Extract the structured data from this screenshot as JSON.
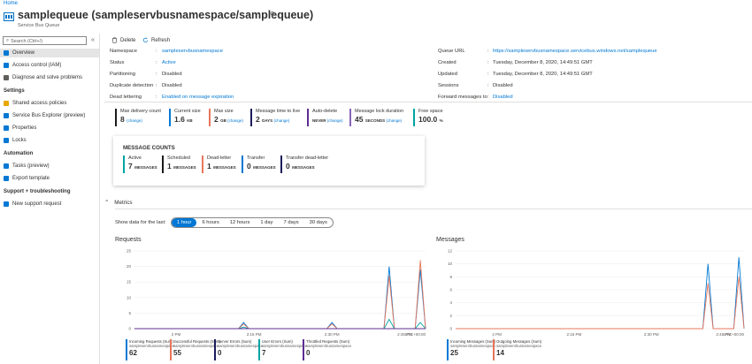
{
  "breadcrumb": "Home",
  "header": {
    "title": "samplequeue (sampleservbusnamespace/samplequeue)",
    "subtitle": "Service Bus Queue",
    "pin_icon": "pin-icon"
  },
  "sidebar": {
    "search_placeholder": "Search (Ctrl+/)",
    "collapse_glyph": "«",
    "items": [
      {
        "label": "Overview",
        "icon": "overview-icon",
        "color": "#0078d4"
      },
      {
        "label": "Access control (IAM)",
        "icon": "people-icon",
        "color": "#0078d4"
      },
      {
        "label": "Diagnose and solve problems",
        "icon": "wrench-icon",
        "color": "#605e5c"
      }
    ],
    "sections": [
      {
        "title": "Settings",
        "items": [
          {
            "label": "Shared access policies",
            "icon": "key-icon",
            "color": "#e8a700"
          },
          {
            "label": "Service Bus Explorer (preview)",
            "icon": "explorer-icon",
            "color": "#0078d4"
          },
          {
            "label": "Properties",
            "icon": "properties-icon",
            "color": "#0078d4"
          },
          {
            "label": "Locks",
            "icon": "lock-icon",
            "color": "#0078d4"
          }
        ]
      },
      {
        "title": "Automation",
        "items": [
          {
            "label": "Tasks (preview)",
            "icon": "tasks-icon",
            "color": "#0078d4"
          },
          {
            "label": "Export template",
            "icon": "export-icon",
            "color": "#0078d4"
          }
        ]
      },
      {
        "title": "Support + troubleshooting",
        "items": [
          {
            "label": "New support request",
            "icon": "support-icon",
            "color": "#0078d4"
          }
        ]
      }
    ]
  },
  "toolbar": {
    "delete_label": "Delete",
    "refresh_label": "Refresh"
  },
  "essentials": {
    "left": [
      {
        "label": "Namespace",
        "value": "sampleservbusnamespace",
        "link": true
      },
      {
        "label": "Status",
        "value": "Active",
        "link": true
      },
      {
        "label": "Partitioning",
        "value": "Disabled",
        "link": false
      },
      {
        "label": "Duplicate detection",
        "value": "Disabled",
        "link": false
      },
      {
        "label": "Dead lettering",
        "value": "Enabled on message expiration",
        "link": true
      }
    ],
    "right": [
      {
        "label": "Queue URL",
        "value": "https://sampleservbusnamespace.servicebus.windows.net/samplequeue",
        "link": true
      },
      {
        "label": "Created",
        "value": "Tuesday, December 8, 2020, 14:49:51 GMT",
        "link": false
      },
      {
        "label": "Updated",
        "value": "Tuesday, December 8, 2020, 14:49:51 GMT",
        "link": false
      },
      {
        "label": "Sessions",
        "value": "Disabled",
        "link": false
      },
      {
        "label": "Forward messages to",
        "value": "Disabled",
        "link": true
      }
    ]
  },
  "tiles": [
    {
      "label": "Max delivery count",
      "value": "8",
      "unit": "",
      "change": "(change)",
      "color": "#1b1b1b"
    },
    {
      "label": "Current size",
      "value": "1.6",
      "unit": "KB",
      "change": "",
      "color": "#0078d4"
    },
    {
      "label": "Max size",
      "value": "2",
      "unit": "GB",
      "change": "(change)",
      "color": "#e8765a"
    },
    {
      "label": "Message time to live",
      "value": "2",
      "unit": "DAYS",
      "change": "(change)",
      "color": "#1b1b5a"
    },
    {
      "label": "Auto-delete",
      "value": "",
      "unit": "NEVER",
      "change": "(change)",
      "color": "#5c2d91"
    },
    {
      "label": "Message lock duration",
      "value": "45",
      "unit": "SECONDS",
      "change": "(change)",
      "color": "#8764b8"
    },
    {
      "label": "Free space",
      "value": "100.0",
      "unit": "%",
      "change": "",
      "color": "#00a3a3"
    }
  ],
  "message_counts": {
    "title": "MESSAGE COUNTS",
    "items": [
      {
        "label": "Active",
        "value": "7",
        "unit": "MESSAGES",
        "color": "#00a3a3"
      },
      {
        "label": "Scheduled",
        "value": "1",
        "unit": "MESSAGES",
        "color": "#1b1b1b"
      },
      {
        "label": "Dead-letter",
        "value": "1",
        "unit": "MESSAGES",
        "color": "#e8765a"
      },
      {
        "label": "Transfer",
        "value": "0",
        "unit": "MESSAGES",
        "color": "#0078d4"
      },
      {
        "label": "Transfer dead-letter",
        "value": "0",
        "unit": "MESSAGES",
        "color": "#1b1b5a"
      }
    ]
  },
  "metrics": {
    "title": "Metrics",
    "show_label": "Show data for the last:",
    "ranges": [
      "1 hour",
      "6 hours",
      "12 hours",
      "1 day",
      "7 days",
      "30 days"
    ],
    "selected": "1 hour"
  },
  "chart_data": [
    {
      "type": "line",
      "title": "Requests",
      "x_ticks": [
        "2 PM",
        "2:15 PM",
        "2:30 PM",
        "2:45 PM",
        "UTC+00:00"
      ],
      "ylim": [
        0,
        25
      ],
      "y_ticks": [
        0,
        5,
        10,
        15,
        20,
        25
      ],
      "series": [
        {
          "name": "Incoming Requests (Sum)",
          "color": "#0078d4",
          "points": [
            [
              0,
              0
            ],
            [
              20,
              0
            ],
            [
              21,
              2
            ],
            [
              22,
              0
            ],
            [
              37,
              0
            ],
            [
              38,
              2
            ],
            [
              39,
              0
            ],
            [
              48,
              0
            ],
            [
              49,
              20
            ],
            [
              50,
              0
            ],
            [
              54,
              0
            ],
            [
              55,
              19
            ],
            [
              56,
              0
            ]
          ]
        },
        {
          "name": "Successful Requests (Sum)",
          "color": "#e8765a",
          "points": [
            [
              0,
              0
            ],
            [
              20,
              0
            ],
            [
              21,
              1.5
            ],
            [
              22,
              0
            ],
            [
              37,
              0
            ],
            [
              38,
              1.5
            ],
            [
              39,
              0
            ],
            [
              48,
              0
            ],
            [
              49,
              17
            ],
            [
              50,
              0
            ],
            [
              54,
              0
            ],
            [
              55,
              22
            ],
            [
              56,
              0
            ]
          ]
        },
        {
          "name": "Server Errors (Sum)",
          "color": "#1b1b5a",
          "points": [
            [
              0,
              0
            ],
            [
              56,
              0
            ]
          ]
        },
        {
          "name": "User Errors (Sum)",
          "color": "#00a3a3",
          "points": [
            [
              0,
              0
            ],
            [
              20,
              0
            ],
            [
              21,
              0.5
            ],
            [
              22,
              0
            ],
            [
              48,
              0
            ],
            [
              49,
              3
            ],
            [
              50,
              0
            ],
            [
              54,
              0
            ],
            [
              55,
              2
            ],
            [
              56,
              0
            ]
          ]
        },
        {
          "name": "Throttled Requests (Sum)",
          "color": "#5c2d91",
          "points": [
            [
              0,
              0
            ],
            [
              56,
              0
            ]
          ]
        }
      ],
      "legend": [
        {
          "name": "Incoming Requests (Sum)",
          "sub": "sampleservbusnamespace",
          "value": "62",
          "color": "#0078d4"
        },
        {
          "name": "Successful Requests (Sum)",
          "sub": "sampleservbusnamespace",
          "value": "55",
          "color": "#e8765a"
        },
        {
          "name": "Server Errors (Sum)",
          "sub": "sampleservbusnamespace",
          "value": "0",
          "color": "#1b1b5a"
        },
        {
          "name": "User Errors (Sum)",
          "sub": "sampleservbusnamespace",
          "value": "7",
          "color": "#00a3a3"
        },
        {
          "name": "Throttled Requests (Sum)",
          "sub": "sampleservbusnamespace",
          "value": "0",
          "color": "#5c2d91"
        }
      ]
    },
    {
      "type": "line",
      "title": "Messages",
      "x_ticks": [
        "2 PM",
        "2:15 PM",
        "2:30 PM",
        "2:45 PM",
        "UTC+00:00"
      ],
      "ylim": [
        0,
        12
      ],
      "y_ticks": [
        0,
        2,
        4,
        6,
        8,
        10,
        12
      ],
      "series": [
        {
          "name": "Incoming Messages (Sum)",
          "color": "#0078d4",
          "points": [
            [
              0,
              0
            ],
            [
              48,
              0
            ],
            [
              49,
              10
            ],
            [
              50,
              0
            ],
            [
              54,
              0
            ],
            [
              55,
              11
            ],
            [
              56,
              0
            ]
          ]
        },
        {
          "name": "Outgoing Messages (Sum)",
          "color": "#e8765a",
          "points": [
            [
              0,
              0
            ],
            [
              48,
              0
            ],
            [
              49,
              7
            ],
            [
              50,
              0
            ],
            [
              54,
              0
            ],
            [
              55,
              8
            ],
            [
              56,
              0
            ]
          ]
        }
      ],
      "legend": [
        {
          "name": "Incoming Messages (Sum)",
          "sub": "sampleservbusnamespace",
          "value": "25",
          "color": "#0078d4"
        },
        {
          "name": "Outgoing Messages (Sum)",
          "sub": "sampleservbusnamespace",
          "value": "14",
          "color": "#e8765a"
        }
      ]
    }
  ]
}
